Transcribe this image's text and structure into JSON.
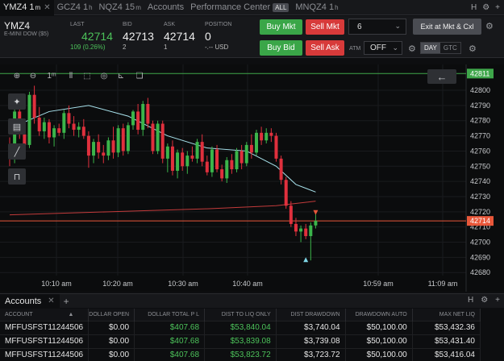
{
  "tabs": [
    {
      "name": "tab-ymz4",
      "label": "YMZ4 1",
      "sup": "m",
      "active": true,
      "close": true
    },
    {
      "name": "tab-gcz4",
      "label": "GCZ4 1",
      "sup": "h",
      "active": false,
      "close": false
    },
    {
      "name": "tab-nqz4-15m",
      "label": "NQZ4 15",
      "sup": "m",
      "active": false,
      "close": false
    },
    {
      "name": "tab-accounts",
      "label": "Accounts",
      "sup": "",
      "active": false,
      "close": false
    },
    {
      "name": "tab-performance",
      "label": "Performance Center",
      "sup": "",
      "badge": "ALL",
      "active": false,
      "close": false
    },
    {
      "name": "tab-nqz4-1h",
      "label": "MNQZ4 1",
      "sup": "h",
      "active": false,
      "close": false
    }
  ],
  "tabbar_right": {
    "h": "H",
    "settings": "⚙",
    "plus": "+"
  },
  "quote": {
    "symbol": "YMZ4",
    "description": "E-MINI DOW ($5)",
    "last_label": "LAST",
    "last": "42714",
    "change": "109 (0.26%)",
    "bid_label": "BID",
    "bid": "42713",
    "bid_size": "2",
    "ask_label": "ASK",
    "ask": "42714",
    "ask_size": "1",
    "position_label": "POSITION",
    "position": "0",
    "position_sub": "-.-- USD"
  },
  "orders": {
    "buy_mkt": "Buy Mkt",
    "sell_mkt": "Sell Mkt",
    "buy_bid": "Buy Bid",
    "sell_ask": "Sell Ask",
    "quantity": "6",
    "exit": "Exit at Mkt & Cxl",
    "atm_label": "ATM",
    "atm_value": "OFF",
    "day": "DAY",
    "gtc": "GTC"
  },
  "colors": {
    "up": "#3bb54a",
    "down": "#e0303d",
    "ema": "#a9e4ee",
    "sma": "#c33b3b",
    "last_price": "#e8573a",
    "reference": "#3ea64a"
  },
  "chart_data": {
    "type": "candlestick",
    "ylim": [
      42678,
      42817
    ],
    "yticks": [
      42680,
      42690,
      42700,
      42710,
      42720,
      42730,
      42740,
      42750,
      42760,
      42770,
      42780,
      42790,
      42800
    ],
    "xticks": [
      "10:10 am",
      "10:20 am",
      "10:30 am",
      "10:40 am",
      "10:59 am",
      "11:09 am"
    ],
    "last_price": 42714,
    "reference_price": 42811,
    "candles": [
      [
        42758,
        42769,
        42750,
        42756
      ],
      [
        42756,
        42788,
        42752,
        42786
      ],
      [
        42786,
        42789,
        42768,
        42771
      ],
      [
        42771,
        42774,
        42757,
        42764
      ],
      [
        42764,
        42799,
        42762,
        42797
      ],
      [
        42797,
        42803,
        42778,
        42782
      ],
      [
        42782,
        42789,
        42770,
        42773
      ],
      [
        42773,
        42782,
        42768,
        42779
      ],
      [
        42779,
        42781,
        42765,
        42769
      ],
      [
        42769,
        42777,
        42763,
        42775
      ],
      [
        42775,
        42778,
        42770,
        42772
      ],
      [
        42772,
        42787,
        42768,
        42785
      ],
      [
        42785,
        42790,
        42775,
        42778
      ],
      [
        42778,
        42783,
        42770,
        42774
      ],
      [
        42774,
        42779,
        42769,
        42776
      ],
      [
        42776,
        42781,
        42768,
        42770
      ],
      [
        42770,
        42773,
        42749,
        42757
      ],
      [
        42757,
        42768,
        42752,
        42766
      ],
      [
        42766,
        42771,
        42755,
        42759
      ],
      [
        42759,
        42764,
        42752,
        42757
      ],
      [
        42757,
        42769,
        42754,
        42767
      ],
      [
        42767,
        42776,
        42755,
        42759
      ],
      [
        42759,
        42777,
        42756,
        42775
      ],
      [
        42775,
        42778,
        42757,
        42760
      ],
      [
        42760,
        42779,
        42758,
        42777
      ],
      [
        42777,
        42787,
        42774,
        42786
      ],
      [
        42786,
        42791,
        42771,
        42774
      ],
      [
        42774,
        42793,
        42770,
        42791
      ],
      [
        42791,
        42795,
        42775,
        42778
      ],
      [
        42778,
        42780,
        42758,
        42760
      ],
      [
        42760,
        42780,
        42758,
        42778
      ],
      [
        42778,
        42780,
        42752,
        42755
      ],
      [
        42755,
        42765,
        42746,
        42763
      ],
      [
        42763,
        42767,
        42744,
        42747
      ],
      [
        42747,
        42761,
        42742,
        42759
      ],
      [
        42759,
        42762,
        42747,
        42750
      ],
      [
        42750,
        42760,
        42745,
        42757
      ],
      [
        42757,
        42763,
        42753,
        42755
      ],
      [
        42755,
        42768,
        42752,
        42766
      ],
      [
        42766,
        42771,
        42750,
        42753
      ],
      [
        42753,
        42757,
        42744,
        42746
      ],
      [
        42746,
        42763,
        42743,
        42761
      ],
      [
        42761,
        42764,
        42746,
        42748
      ],
      [
        42748,
        42751,
        42740,
        42742
      ],
      [
        42742,
        42756,
        42739,
        42754
      ],
      [
        42754,
        42758,
        42745,
        42748
      ],
      [
        42748,
        42762,
        42746,
        42760
      ],
      [
        42760,
        42764,
        42748,
        42752
      ],
      [
        42752,
        42766,
        42750,
        42764
      ],
      [
        42764,
        42771,
        42755,
        42759
      ],
      [
        42759,
        42774,
        42757,
        42772
      ],
      [
        42772,
        42776,
        42764,
        42767
      ],
      [
        42767,
        42775,
        42765,
        42772
      ],
      [
        42772,
        42775,
        42766,
        42770
      ],
      [
        42770,
        42772,
        42753,
        42755
      ],
      [
        42755,
        42757,
        42738,
        42741
      ],
      [
        42741,
        42743,
        42722,
        42724
      ],
      [
        42724,
        42727,
        42710,
        42712
      ],
      [
        42712,
        42716,
        42704,
        42707
      ],
      [
        42707,
        42711,
        42700,
        42709
      ],
      [
        42709,
        42712,
        42702,
        42704
      ],
      [
        42704,
        42713,
        42688,
        42711
      ],
      [
        42711,
        42719,
        42709,
        42714
      ]
    ],
    "ema": [
      [
        0,
        42775
      ],
      [
        8,
        42786
      ],
      [
        16,
        42790
      ],
      [
        24,
        42783
      ],
      [
        32,
        42770
      ],
      [
        40,
        42762
      ],
      [
        48,
        42760
      ],
      [
        54,
        42750
      ],
      [
        58,
        42738
      ],
      [
        62,
        42733
      ]
    ],
    "sma": [
      [
        0,
        42718
      ],
      [
        20,
        42720
      ],
      [
        40,
        42722
      ],
      [
        54,
        42724
      ],
      [
        62,
        42727
      ]
    ],
    "markers": [
      {
        "bar": 60,
        "price": 42689,
        "side": "buy"
      },
      {
        "bar": 62,
        "price": 42719,
        "side": "sell"
      }
    ]
  },
  "accounts": {
    "tab": "Accounts",
    "columns": [
      "ACCOUNT",
      "DOLLAR OPEN",
      "DOLLAR TOTAL P L",
      "DIST TO LIQ ONLY",
      "DIST DRAWDOWN",
      "DRAWDOWN AUTO",
      "MAX NET LIQ"
    ],
    "sort_icon": "▲",
    "rows": [
      [
        "MFFUSFST11244506",
        "$0.00",
        "$407.68",
        "$53,840.04",
        "$3,740.04",
        "$50,100.00",
        "$53,432.36"
      ],
      [
        "MFFUSFST11244506",
        "$0.00",
        "$407.68",
        "$53,839.08",
        "$3,739.08",
        "$50,100.00",
        "$53,431.40"
      ],
      [
        "MFFUSFST11244506",
        "$0.00",
        "$407.68",
        "$53,823.72",
        "$3,723.72",
        "$50,100.00",
        "$53,416.04"
      ]
    ]
  }
}
